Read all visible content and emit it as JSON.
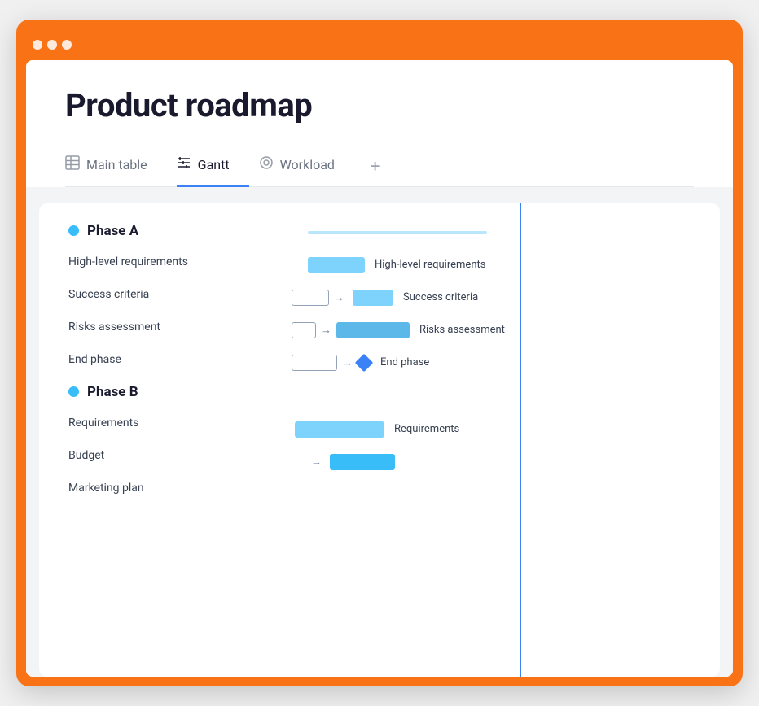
{
  "browser": {
    "dots": [
      "dot1",
      "dot2",
      "dot3"
    ]
  },
  "header": {
    "title": "Product roadmap"
  },
  "tabs": [
    {
      "id": "main-table",
      "label": "Main table",
      "icon": "table-icon",
      "active": false
    },
    {
      "id": "gantt",
      "label": "Gantt",
      "icon": "gantt-icon",
      "active": true
    },
    {
      "id": "workload",
      "label": "Workload",
      "icon": "workload-icon",
      "active": false
    }
  ],
  "tabs_add": "+",
  "phases": [
    {
      "id": "phase-a",
      "label": "Phase A",
      "tasks": [
        "High-level requirements",
        "Success criteria",
        "Risks assessment",
        "End phase"
      ]
    },
    {
      "id": "phase-b",
      "label": "Phase B",
      "tasks": [
        "Requirements",
        "Budget",
        "Marketing plan"
      ]
    }
  ],
  "gantt": {
    "task_labels": {
      "high_level": "High-level requirements",
      "success": "Success criteria",
      "risks": "Risks assessment",
      "end_phase": "End phase",
      "requirements": "Requirements"
    }
  }
}
